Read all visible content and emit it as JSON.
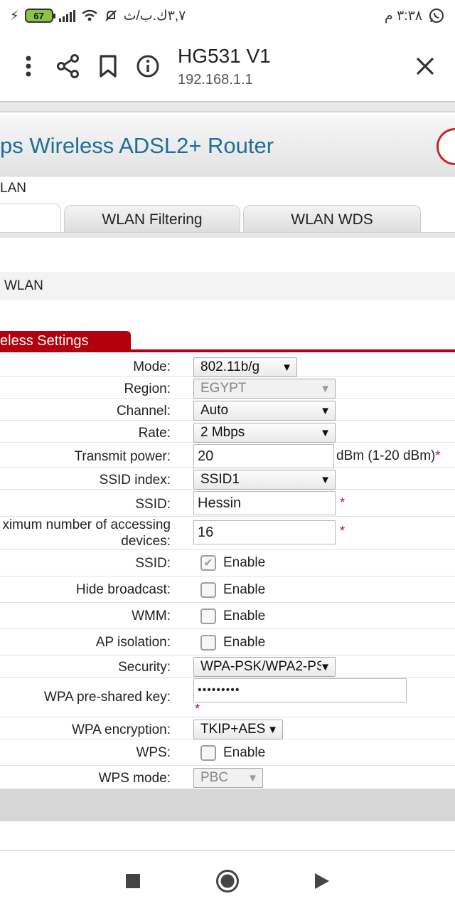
{
  "status": {
    "time": "٣:٣٨ م",
    "battery": "67",
    "speed": "٣,٧ك.ب/ث"
  },
  "browser": {
    "title": "HG531 V1",
    "url": "192.168.1.1"
  },
  "banner": {
    "title": "ps Wireless ADSL2+ Router"
  },
  "crumb": "LAN",
  "tabs": [
    {
      "label": ""
    },
    {
      "label": "WLAN Filtering"
    },
    {
      "label": "WLAN WDS"
    }
  ],
  "section": {
    "title": "WLAN"
  },
  "settings_tab": "eless Settings",
  "form": {
    "mode": {
      "label": "Mode:",
      "value": "802.11b/g"
    },
    "region": {
      "label": "Region:",
      "value": "EGYPT"
    },
    "channel": {
      "label": "Channel:",
      "value": "Auto"
    },
    "rate": {
      "label": "Rate:",
      "value": "2 Mbps"
    },
    "transmit_power": {
      "label": "Transmit power:",
      "value": "20",
      "unit": "dBm (1-20 dBm)",
      "required": "*"
    },
    "ssid_index": {
      "label": "SSID index:",
      "value": "SSID1"
    },
    "ssid": {
      "label": "SSID:",
      "value": "Hessin",
      "required": "*"
    },
    "max_devices": {
      "label_line1": "ximum number of accessing",
      "label_line2": "devices:",
      "value": "16",
      "required": "*"
    },
    "ssid_enable": {
      "label": "SSID:",
      "option": "Enable",
      "checked": true
    },
    "hide_broadcast": {
      "label": "Hide broadcast:",
      "option": "Enable",
      "checked": false
    },
    "wmm": {
      "label": "WMM:",
      "option": "Enable",
      "checked": false
    },
    "ap_isolation": {
      "label": "AP isolation:",
      "option": "Enable",
      "checked": false
    },
    "security": {
      "label": "Security:",
      "value": "WPA-PSK/WPA2-PS"
    },
    "wpa_key": {
      "label": "WPA pre-shared key:",
      "value": "•••••••••",
      "required": "*"
    },
    "wpa_encryption": {
      "label": "WPA encryption:",
      "value": "TKIP+AES"
    },
    "wps": {
      "label": "WPS:",
      "option": "Enable",
      "checked": false
    },
    "wps_mode": {
      "label": "WPS mode:",
      "value": "PBC"
    }
  },
  "colors": {
    "accent_red": "#b3000c",
    "title_blue": "#1d6e9a"
  }
}
